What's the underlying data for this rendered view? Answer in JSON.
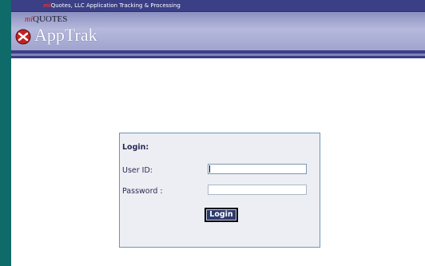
{
  "header": {
    "brand": "mi",
    "tagline": "Quotes, LLC Application Tracking & Processing",
    "logo_prefix": "mi",
    "logo_small": "QUOTES",
    "logo_title": "AppTrak"
  },
  "login": {
    "heading": "Login:",
    "userid_label": "User ID:",
    "userid_value": "",
    "password_label": "Password :",
    "password_value": "",
    "button_label": "Login"
  },
  "colors": {
    "page_background": "#0f6b6a",
    "header_bar": "#3a3f86",
    "login_button": "#2d3a6e",
    "brand_red": "#e03030"
  },
  "icons": {
    "logo": "miquotes-logo-icon"
  }
}
